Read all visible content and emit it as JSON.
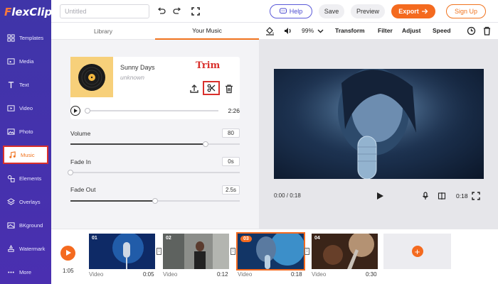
{
  "app": {
    "logo_first": "F",
    "logo_rest": "lexClip"
  },
  "sidebar": {
    "items": [
      {
        "label": "Templates",
        "icon": "grid-icon"
      },
      {
        "label": "Media",
        "icon": "folder-icon"
      },
      {
        "label": "Text",
        "icon": "text-icon"
      },
      {
        "label": "Video",
        "icon": "video-icon"
      },
      {
        "label": "Photo",
        "icon": "photo-icon"
      },
      {
        "label": "Music",
        "icon": "music-icon",
        "active": true
      },
      {
        "label": "Elements",
        "icon": "elements-icon"
      },
      {
        "label": "Overlays",
        "icon": "overlays-icon"
      },
      {
        "label": "BKground",
        "icon": "background-icon"
      },
      {
        "label": "Watermark",
        "icon": "watermark-icon"
      },
      {
        "label": "More",
        "icon": "more-icon"
      }
    ]
  },
  "topbar": {
    "title_placeholder": "Untitled",
    "help_label": "Help",
    "save_label": "Save",
    "preview_label": "Preview",
    "export_label": "Export",
    "signup_label": "Sign Up"
  },
  "panel": {
    "tabs": [
      {
        "label": "Library",
        "active": false
      },
      {
        "label": "Your Music",
        "active": true
      }
    ],
    "song": {
      "title": "Sunny Days",
      "artist": "unknown"
    },
    "annotation": "Trim",
    "duration": "2:26",
    "volume": {
      "label": "Volume",
      "value": "80",
      "level": 0.8
    },
    "fade_in": {
      "label": "Fade In",
      "value": "0s",
      "level": 0
    },
    "fade_out": {
      "label": "Fade Out",
      "value": "2.5s",
      "level": 0.5
    }
  },
  "toolbar": {
    "zoom": "99%",
    "tools": [
      "Transform",
      "Filter",
      "Adjust",
      "Speed"
    ]
  },
  "preview": {
    "current_time": "0:00 / 0:18",
    "end_time": "0:18"
  },
  "timeline": {
    "total": "1:05",
    "clips": [
      {
        "num": "01",
        "type": "Video",
        "duration": "0:05"
      },
      {
        "num": "02",
        "type": "Video",
        "duration": "0:12"
      },
      {
        "num": "03",
        "type": "Video",
        "duration": "0:18",
        "selected": true
      },
      {
        "num": "04",
        "type": "Video",
        "duration": "0:30"
      }
    ]
  },
  "colors": {
    "accent": "#f46a1f",
    "sidebar": "#4a2fb0",
    "highlight": "#d9302c",
    "help": "#5b5ad8"
  }
}
